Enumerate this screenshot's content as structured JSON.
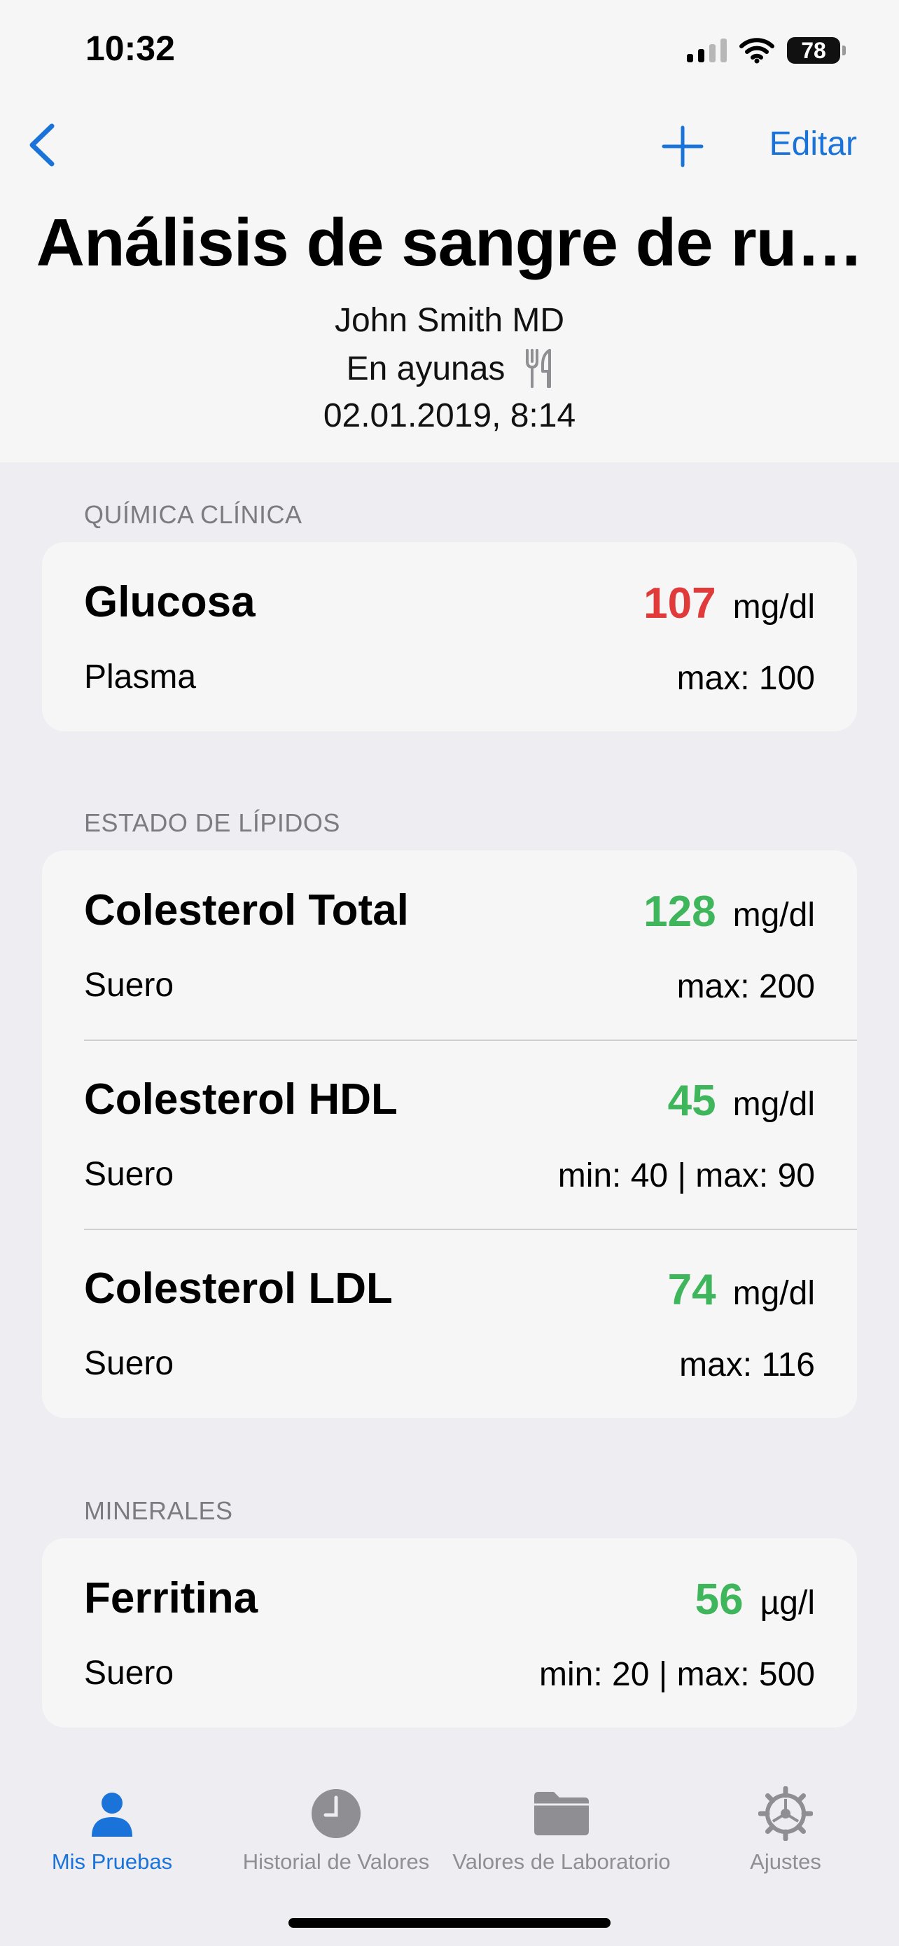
{
  "status_bar": {
    "time": "10:32",
    "battery": "78"
  },
  "nav": {
    "edit_label": "Editar"
  },
  "header": {
    "title": "Análisis de sangre de ru…",
    "doctor": "John Smith MD",
    "fasting": "En ayunas",
    "datetime": "02.01.2019, 8:14"
  },
  "sections": [
    {
      "label": "QUÍMICA CLÍNICA",
      "rows": [
        {
          "name": "Glucosa",
          "value": "107",
          "unit": "mg/dl",
          "sample": "Plasma",
          "range": "max: 100",
          "status": "high"
        }
      ]
    },
    {
      "label": "ESTADO DE LÍPIDOS",
      "rows": [
        {
          "name": "Colesterol Total",
          "value": "128",
          "unit": "mg/dl",
          "sample": "Suero",
          "range": "max: 200",
          "status": "normal"
        },
        {
          "name": "Colesterol HDL",
          "value": "45",
          "unit": "mg/dl",
          "sample": "Suero",
          "range": "min: 40 | max: 90",
          "status": "normal"
        },
        {
          "name": "Colesterol LDL",
          "value": "74",
          "unit": "mg/dl",
          "sample": "Suero",
          "range": "max: 116",
          "status": "normal"
        }
      ]
    },
    {
      "label": "MINERALES",
      "rows": [
        {
          "name": "Ferritina",
          "value": "56",
          "unit": "µg/l",
          "sample": "Suero",
          "range": "min: 20 | max: 500",
          "status": "normal"
        }
      ]
    }
  ],
  "tabs": [
    {
      "label": "Mis Pruebas",
      "icon": "person-icon",
      "active": true
    },
    {
      "label": "Historial de Valores",
      "icon": "clock-icon",
      "active": false
    },
    {
      "label": "Valores de Laboratorio",
      "icon": "folder-icon",
      "active": false
    },
    {
      "label": "Ajustes",
      "icon": "gear-icon",
      "active": false
    }
  ],
  "colors": {
    "accent": "#1a73d9",
    "high": "#e03a3a",
    "normal": "#3fb55c"
  }
}
